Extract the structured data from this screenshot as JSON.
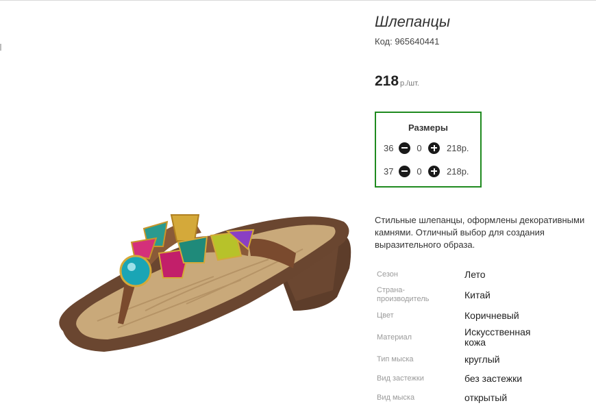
{
  "product": {
    "title": "Шлепанцы",
    "code": "Код: 965640441",
    "price": "218",
    "price_unit": "р./шт.",
    "image_alt": "sandal-with-jewels"
  },
  "sizes": {
    "title": "Размеры",
    "rows": [
      {
        "size": "36",
        "qty": "0",
        "price": "218р."
      },
      {
        "size": "37",
        "qty": "0",
        "price": "218р."
      }
    ]
  },
  "description": "Стильные шлепанцы, оформлены декоративными\nкамнями. Отличный выбор для создания\nвыразительного образа.",
  "attributes": [
    {
      "label": "Сезон",
      "value": "Лето"
    },
    {
      "label": "Страна-\nпроизводитель",
      "value": "Китай"
    },
    {
      "label": "Цвет",
      "value": "Коричневый"
    },
    {
      "label": "Материал",
      "value": "Искусственная\nкожа"
    },
    {
      "label": "Тип мыска",
      "value": "круглый"
    },
    {
      "label": "Вид застежки",
      "value": "без застежки"
    },
    {
      "label": "Вид мыска",
      "value": "открытый"
    }
  ],
  "colors": {
    "sizes_border": "#1e8a1e",
    "sole_brown": "#6a4630",
    "cork": "#c9a97a",
    "strap_brown": "#7a4a2e"
  }
}
